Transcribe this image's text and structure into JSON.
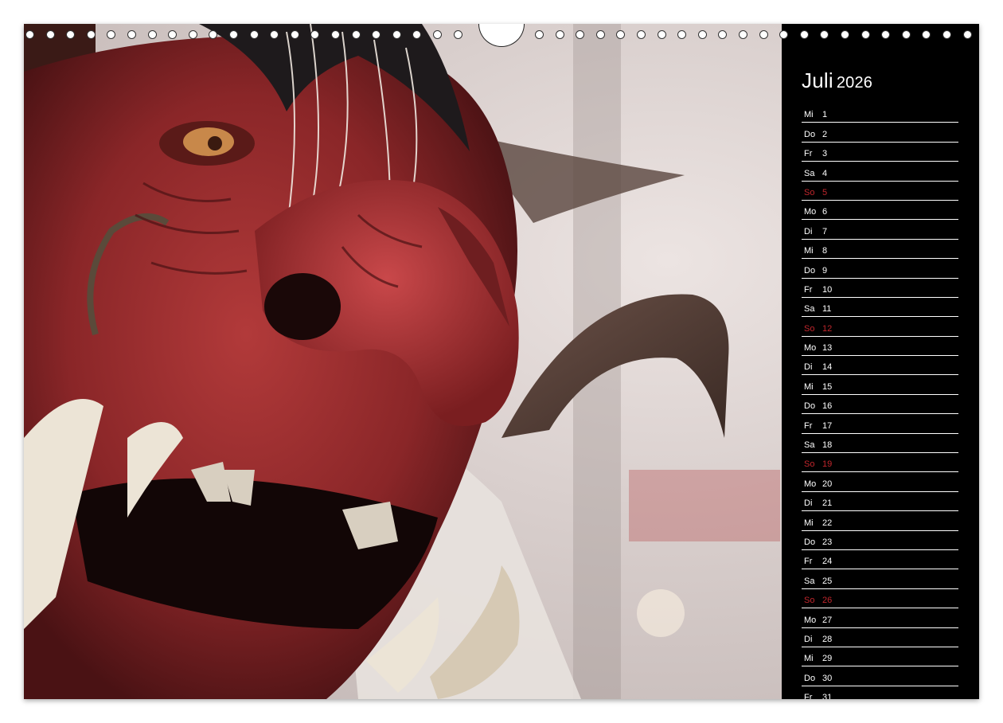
{
  "calendar": {
    "month": "Juli",
    "year": "2026",
    "days": [
      {
        "wd": "Mi",
        "d": "1",
        "sun": false
      },
      {
        "wd": "Do",
        "d": "2",
        "sun": false
      },
      {
        "wd": "Fr",
        "d": "3",
        "sun": false
      },
      {
        "wd": "Sa",
        "d": "4",
        "sun": false
      },
      {
        "wd": "So",
        "d": "5",
        "sun": true
      },
      {
        "wd": "Mo",
        "d": "6",
        "sun": false
      },
      {
        "wd": "Di",
        "d": "7",
        "sun": false
      },
      {
        "wd": "Mi",
        "d": "8",
        "sun": false
      },
      {
        "wd": "Do",
        "d": "9",
        "sun": false
      },
      {
        "wd": "Fr",
        "d": "10",
        "sun": false
      },
      {
        "wd": "Sa",
        "d": "11",
        "sun": false
      },
      {
        "wd": "So",
        "d": "12",
        "sun": true
      },
      {
        "wd": "Mo",
        "d": "13",
        "sun": false
      },
      {
        "wd": "Di",
        "d": "14",
        "sun": false
      },
      {
        "wd": "Mi",
        "d": "15",
        "sun": false
      },
      {
        "wd": "Do",
        "d": "16",
        "sun": false
      },
      {
        "wd": "Fr",
        "d": "17",
        "sun": false
      },
      {
        "wd": "Sa",
        "d": "18",
        "sun": false
      },
      {
        "wd": "So",
        "d": "19",
        "sun": true
      },
      {
        "wd": "Mo",
        "d": "20",
        "sun": false
      },
      {
        "wd": "Di",
        "d": "21",
        "sun": false
      },
      {
        "wd": "Mi",
        "d": "22",
        "sun": false
      },
      {
        "wd": "Do",
        "d": "23",
        "sun": false
      },
      {
        "wd": "Fr",
        "d": "24",
        "sun": false
      },
      {
        "wd": "Sa",
        "d": "25",
        "sun": false
      },
      {
        "wd": "So",
        "d": "26",
        "sun": true
      },
      {
        "wd": "Mo",
        "d": "27",
        "sun": false
      },
      {
        "wd": "Di",
        "d": "28",
        "sun": false
      },
      {
        "wd": "Mi",
        "d": "29",
        "sun": false
      },
      {
        "wd": "Do",
        "d": "30",
        "sun": false
      },
      {
        "wd": "Fr",
        "d": "31",
        "sun": false
      }
    ]
  },
  "colors": {
    "panel_bg": "#000000",
    "text": "#ffffff",
    "sunday": "#c0262c",
    "mask_red": "#8e2a2c"
  },
  "photo": {
    "icon": "krampus-mask-photo"
  }
}
